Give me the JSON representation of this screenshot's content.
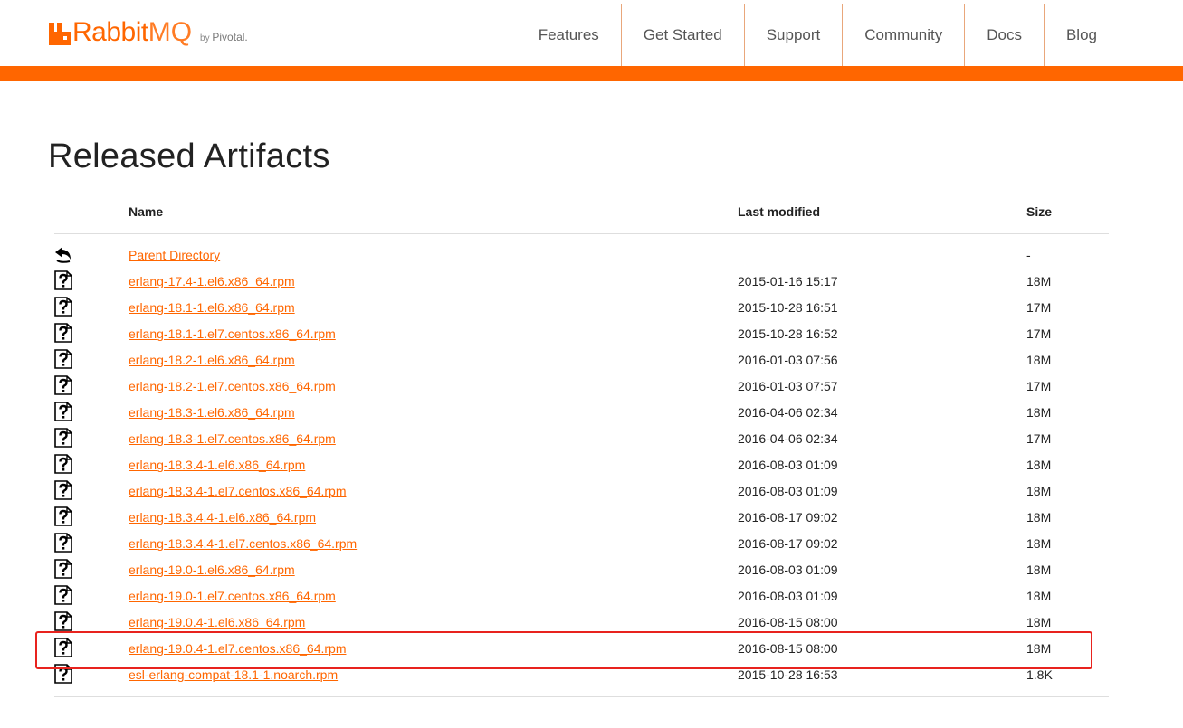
{
  "header": {
    "logo_rabbit": "Rabbit",
    "logo_mq": "MQ",
    "logo_by": "by",
    "logo_pivotal": "Pivotal.",
    "nav": [
      "Features",
      "Get Started",
      "Support",
      "Community",
      "Docs",
      "Blog"
    ],
    "accent_color": "#ff6600"
  },
  "page": {
    "title": "Released Artifacts"
  },
  "table": {
    "headers": {
      "name": "Name",
      "modified": "Last modified",
      "size": "Size"
    },
    "rows": [
      {
        "icon": "back-icon",
        "name": "Parent Directory",
        "date": "",
        "size": "-"
      },
      {
        "icon": "file-icon",
        "name": "erlang-17.4-1.el6.x86_64.rpm",
        "date": "2015-01-16 15:17",
        "size": "18M"
      },
      {
        "icon": "file-icon",
        "name": "erlang-18.1-1.el6.x86_64.rpm",
        "date": "2015-10-28 16:51",
        "size": "17M"
      },
      {
        "icon": "file-icon",
        "name": "erlang-18.1-1.el7.centos.x86_64.rpm",
        "date": "2015-10-28 16:52",
        "size": "17M"
      },
      {
        "icon": "file-icon",
        "name": "erlang-18.2-1.el6.x86_64.rpm",
        "date": "2016-01-03 07:56",
        "size": "18M"
      },
      {
        "icon": "file-icon",
        "name": "erlang-18.2-1.el7.centos.x86_64.rpm",
        "date": "2016-01-03 07:57",
        "size": "17M"
      },
      {
        "icon": "file-icon",
        "name": "erlang-18.3-1.el6.x86_64.rpm",
        "date": "2016-04-06 02:34",
        "size": "18M"
      },
      {
        "icon": "file-icon",
        "name": "erlang-18.3-1.el7.centos.x86_64.rpm",
        "date": "2016-04-06 02:34",
        "size": "17M"
      },
      {
        "icon": "file-icon",
        "name": "erlang-18.3.4-1.el6.x86_64.rpm",
        "date": "2016-08-03 01:09",
        "size": "18M"
      },
      {
        "icon": "file-icon",
        "name": "erlang-18.3.4-1.el7.centos.x86_64.rpm",
        "date": "2016-08-03 01:09",
        "size": "18M"
      },
      {
        "icon": "file-icon",
        "name": "erlang-18.3.4.4-1.el6.x86_64.rpm",
        "date": "2016-08-17 09:02",
        "size": "18M"
      },
      {
        "icon": "file-icon",
        "name": "erlang-18.3.4.4-1.el7.centos.x86_64.rpm",
        "date": "2016-08-17 09:02",
        "size": "18M"
      },
      {
        "icon": "file-icon",
        "name": "erlang-19.0-1.el6.x86_64.rpm",
        "date": "2016-08-03 01:09",
        "size": "18M"
      },
      {
        "icon": "file-icon",
        "name": "erlang-19.0-1.el7.centos.x86_64.rpm",
        "date": "2016-08-03 01:09",
        "size": "18M"
      },
      {
        "icon": "file-icon",
        "name": "erlang-19.0.4-1.el6.x86_64.rpm",
        "date": "2016-08-15 08:00",
        "size": "18M"
      },
      {
        "icon": "file-icon",
        "name": "erlang-19.0.4-1.el7.centos.x86_64.rpm",
        "date": "2016-08-15 08:00",
        "size": "18M"
      },
      {
        "icon": "file-icon",
        "name": "esl-erlang-compat-18.1-1.noarch.rpm",
        "date": "2015-10-28 16:53",
        "size": "1.8K"
      }
    ]
  },
  "highlight_color": "#e8231e"
}
